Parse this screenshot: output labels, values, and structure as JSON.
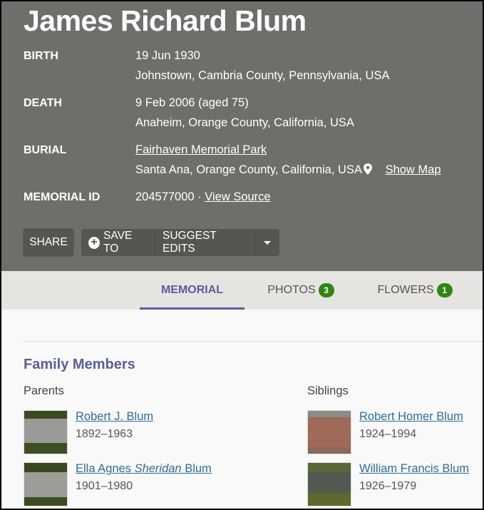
{
  "memorial": {
    "name": "James Richard Blum",
    "facts": {
      "birth": {
        "label": "BIRTH",
        "date": "19 Jun 1930",
        "place": "Johnstown, Cambria County, Pennsylvania, USA"
      },
      "death": {
        "label": "DEATH",
        "date": "9 Feb 2006 (aged 75)",
        "place": "Anaheim, Orange County, California, USA"
      },
      "burial": {
        "label": "BURIAL",
        "cemetery": "Fairhaven Memorial Park",
        "place": "Santa Ana, Orange County, California, USA",
        "map_icon": "map-pin-icon",
        "show_map": "Show Map"
      },
      "memorial_id": {
        "label": "MEMORIAL ID",
        "value": "204577000",
        "separator": " · ",
        "view_source": "View Source"
      }
    }
  },
  "actions": {
    "share": "SHARE",
    "save_to": "SAVE TO",
    "save_icon": "plus-circle-icon",
    "suggest_edits": "SUGGEST EDITS",
    "more_icon": "caret-down-icon"
  },
  "tabs": [
    {
      "label": "MEMORIAL",
      "active": true
    },
    {
      "label": "PHOTOS",
      "count": "3"
    },
    {
      "label": "FLOWERS",
      "count": "1"
    }
  ],
  "family": {
    "title": "Family Members",
    "parents": {
      "title": "Parents",
      "items": [
        {
          "name": "Robert J. Blum",
          "dates": "1892–1963"
        },
        {
          "first": "Ella Agnes ",
          "maiden": "Sheridan",
          "last": " Blum",
          "dates": "1901–1980"
        }
      ]
    },
    "siblings": {
      "title": "Siblings",
      "items": [
        {
          "name": "Robert Homer Blum",
          "dates": "1924–1994"
        },
        {
          "name": "William Francis Blum",
          "dates": "1926–1979"
        }
      ]
    }
  },
  "colors": {
    "hero_bg": "#706e6b",
    "accent": "#5c5d9c",
    "link": "#2f6e98",
    "badge": "#2f860f"
  }
}
